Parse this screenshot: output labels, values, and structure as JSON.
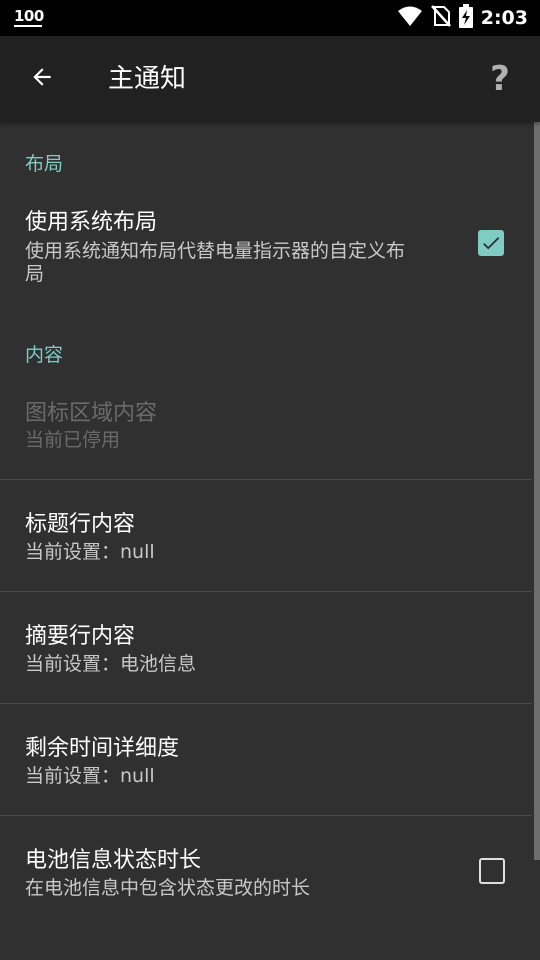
{
  "status_bar": {
    "left_indicator": "100",
    "time": "2:03",
    "icons": [
      "wifi-icon",
      "no-sim-icon",
      "battery-charging-icon"
    ]
  },
  "app_bar": {
    "title": "主通知",
    "back_icon": "arrow-back-icon",
    "help_icon": "help-icon",
    "help_label": "?"
  },
  "sections": [
    {
      "category": "布局",
      "items": [
        {
          "title": "使用系统布局",
          "summary_line1": "使用系统通知布局代替电量指示器的自定义布",
          "summary_line2": "局",
          "checkbox": "checked"
        }
      ]
    },
    {
      "category": "内容",
      "items": [
        {
          "title": "图标区域内容",
          "summary": "当前已停用",
          "enabled": false
        },
        {
          "title": "标题行内容",
          "summary": "当前设置：null"
        },
        {
          "title": "摘要行内容",
          "summary": "当前设置：电池信息"
        },
        {
          "title": "剩余时间详细度",
          "summary": "当前设置：null"
        },
        {
          "title": "电池信息状态时长",
          "summary": "在电池信息中包含状态更改的时长",
          "checkbox": "unchecked"
        }
      ]
    }
  ],
  "colors": {
    "accent": "#80cbc4",
    "background": "#303030",
    "appbar": "#212121",
    "statusbar": "#000000"
  }
}
